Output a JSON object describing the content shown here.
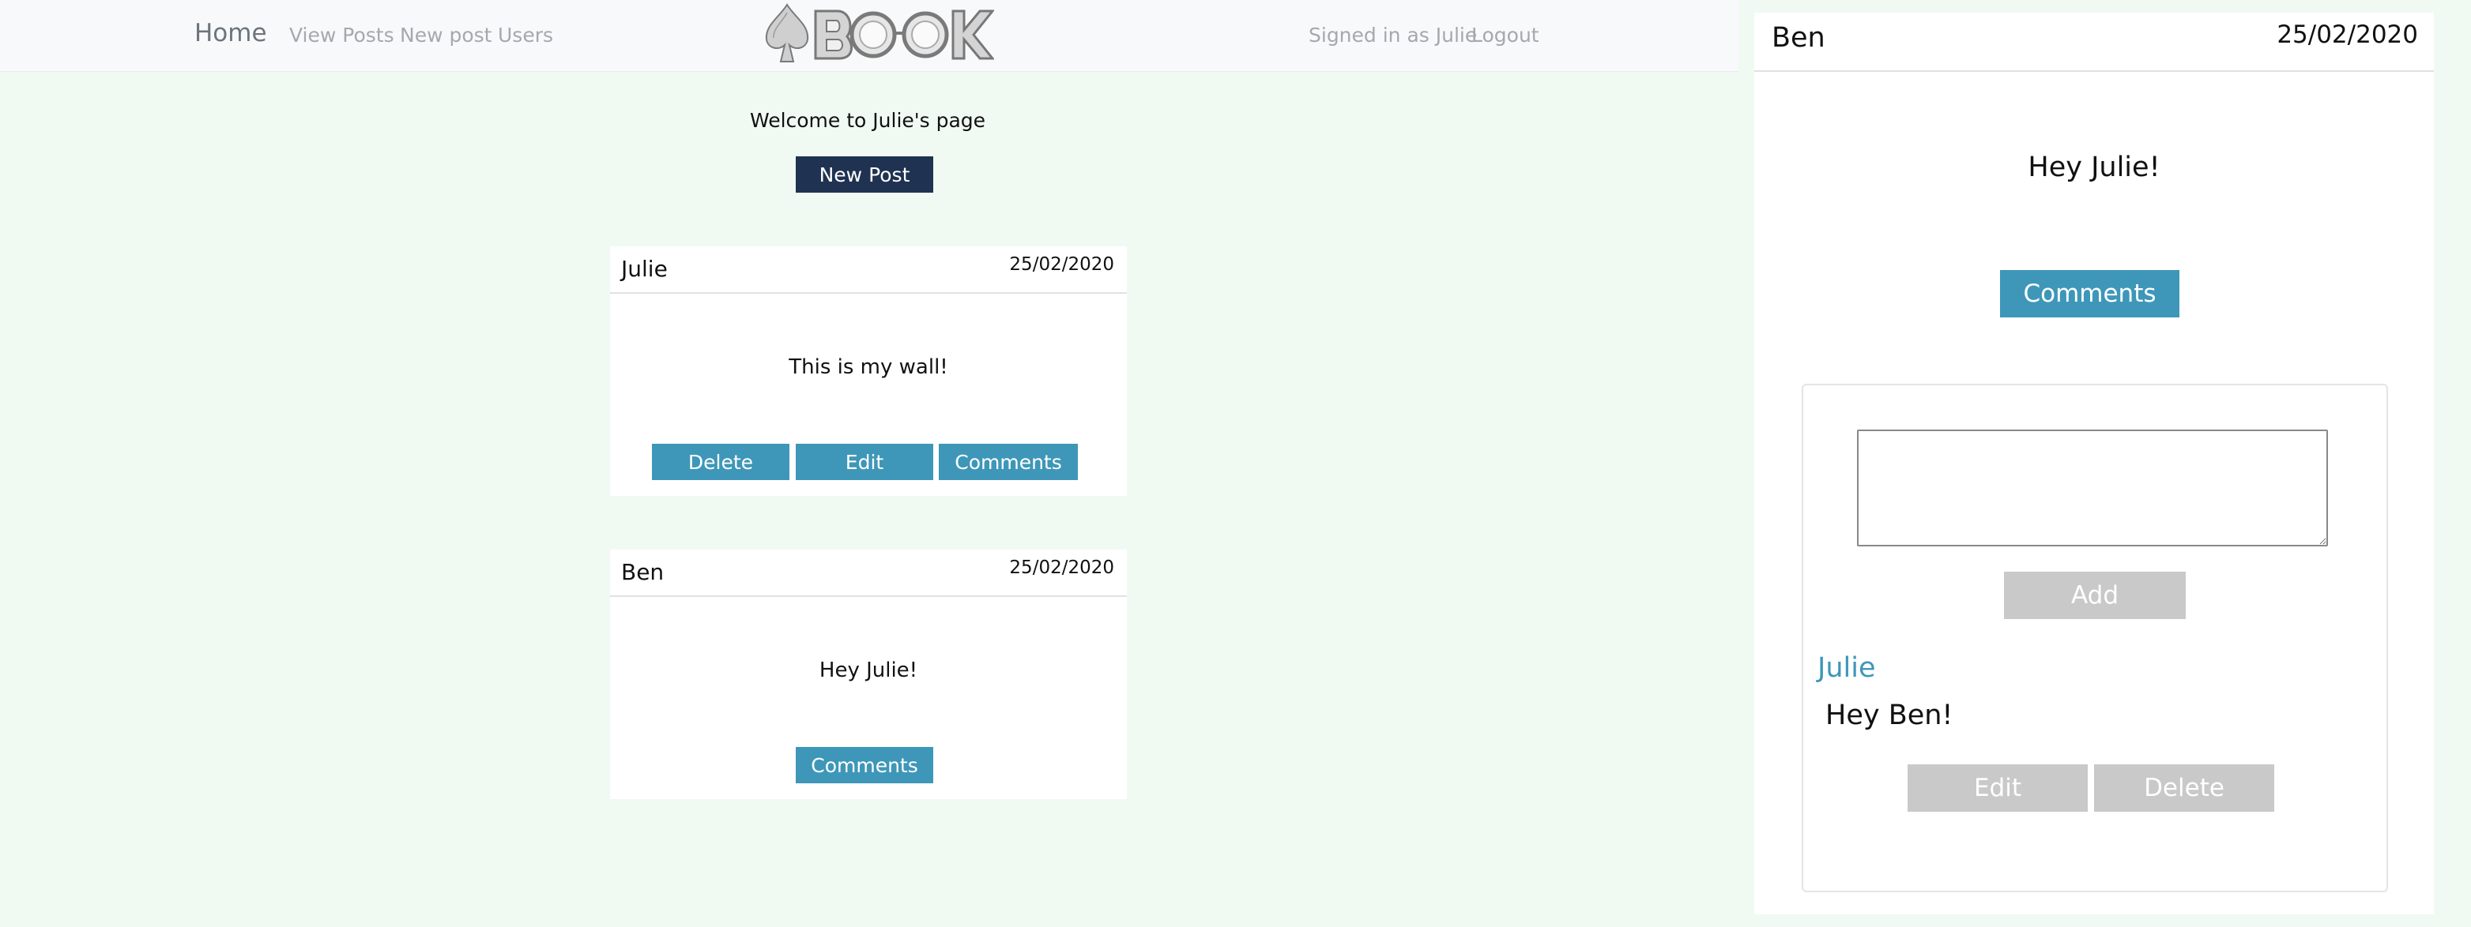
{
  "nav": {
    "brand": "Home",
    "links": [
      "View Posts",
      "New post",
      "Users"
    ],
    "signed_in": "Signed in as Julie",
    "logout": "Logout",
    "logo_text": "BOOK"
  },
  "main": {
    "welcome": "Welcome to Julie's page",
    "new_post_label": "New Post"
  },
  "posts": [
    {
      "author": "Julie",
      "date": "25/02/2020",
      "body": "This is my wall!",
      "buttons": [
        "Delete",
        "Edit",
        "Comments"
      ]
    },
    {
      "author": "Ben",
      "date": "25/02/2020",
      "body": "Hey Julie!",
      "buttons": [
        "Comments"
      ]
    }
  ],
  "panel": {
    "author": "Ben",
    "date": "25/02/2020",
    "body": "Hey Julie!",
    "comments_label": "Comments",
    "input_value": "",
    "add_label": "Add",
    "comment": {
      "author": "Julie",
      "text": "Hey Ben!",
      "edit_label": "Edit",
      "delete_label": "Delete"
    }
  },
  "colors": {
    "background": "#f0faf2",
    "navbar": "#f8f9fa",
    "info_button": "#3e97b8",
    "dark_button": "#1f3251",
    "disabled_button": "#c9c9c9",
    "comment_author": "#3e97b8"
  }
}
